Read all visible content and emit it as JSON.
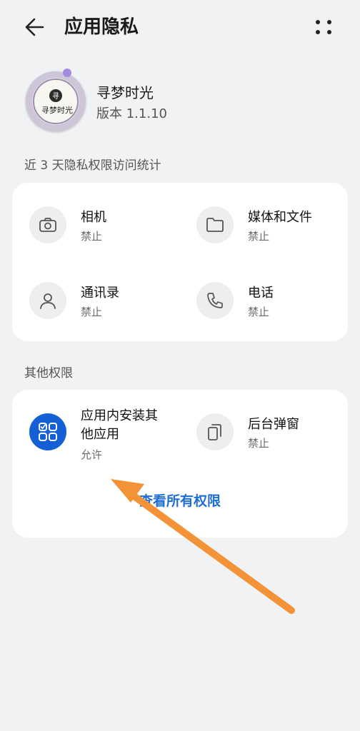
{
  "header": {
    "title": "应用隐私",
    "back_icon": "arrow-left-icon",
    "more_icon": "more-dots-icon"
  },
  "app": {
    "name": "寻梦时光",
    "version": "版本 1.1.10",
    "logo_text": "寻梦时光"
  },
  "recent_section": {
    "title": "近 3 天隐私权限访问统计",
    "items": [
      {
        "label": "相机",
        "status": "禁止",
        "icon": "camera-icon"
      },
      {
        "label": "媒体和文件",
        "status": "禁止",
        "icon": "folder-icon"
      },
      {
        "label": "通讯录",
        "status": "禁止",
        "icon": "contacts-icon"
      },
      {
        "label": "电话",
        "status": "禁止",
        "icon": "phone-icon"
      }
    ]
  },
  "other_section": {
    "title": "其他权限",
    "items": [
      {
        "label_line1": "应用内安装其",
        "label_line2": "他应用",
        "status": "允许",
        "icon": "app-install-icon"
      },
      {
        "label": "后台弹窗",
        "status": "禁止",
        "icon": "popup-window-icon"
      }
    ],
    "view_all": "查看所有权限"
  },
  "annotation": {
    "color": "#f39237"
  }
}
